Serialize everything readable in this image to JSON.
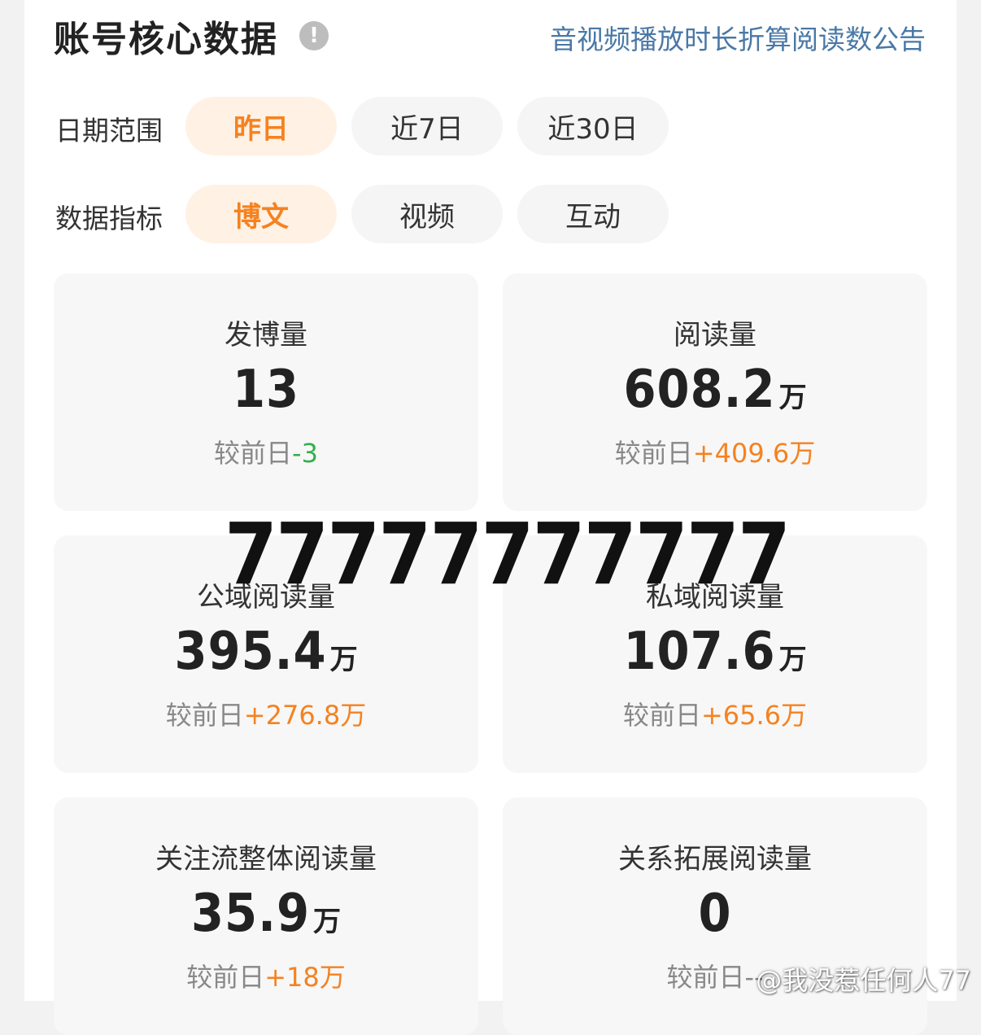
{
  "header": {
    "title": "账号核心数据",
    "info_icon": "!",
    "notice_link": "音视频播放时长折算阅读数公告"
  },
  "date_range": {
    "label": "日期范围",
    "options": [
      "昨日",
      "近7日",
      "近30日"
    ],
    "selected": "昨日"
  },
  "metric_type": {
    "label": "数据指标",
    "options": [
      "博文",
      "视频",
      "互动"
    ],
    "selected": "博文"
  },
  "compare_label": "较前日",
  "cards": [
    {
      "label": "发博量",
      "value": "13",
      "unit": "",
      "delta": "-3",
      "delta_dir": "down"
    },
    {
      "label": "阅读量",
      "value": "608.2",
      "unit": "万",
      "delta": "+409.6万",
      "delta_dir": "up"
    },
    {
      "label": "公域阅读量",
      "value": "395.4",
      "unit": "万",
      "delta": "+276.8万",
      "delta_dir": "up"
    },
    {
      "label": "私域阅读量",
      "value": "107.6",
      "unit": "万",
      "delta": "+65.6万",
      "delta_dir": "up"
    },
    {
      "label": "关注流整体阅读量",
      "value": "35.9",
      "unit": "万",
      "delta": "+18万",
      "delta_dir": "up"
    },
    {
      "label": "关系拓展阅读量",
      "value": "0",
      "unit": "",
      "delta": "--",
      "delta_dir": "none"
    }
  ],
  "overlay_text": "77777777777",
  "watermark": "@我没惹任何人77",
  "colors": {
    "accent": "#f58220",
    "accent_bg": "#fff1e4",
    "link": "#4a78a6",
    "delta_down": "#31b14b"
  }
}
